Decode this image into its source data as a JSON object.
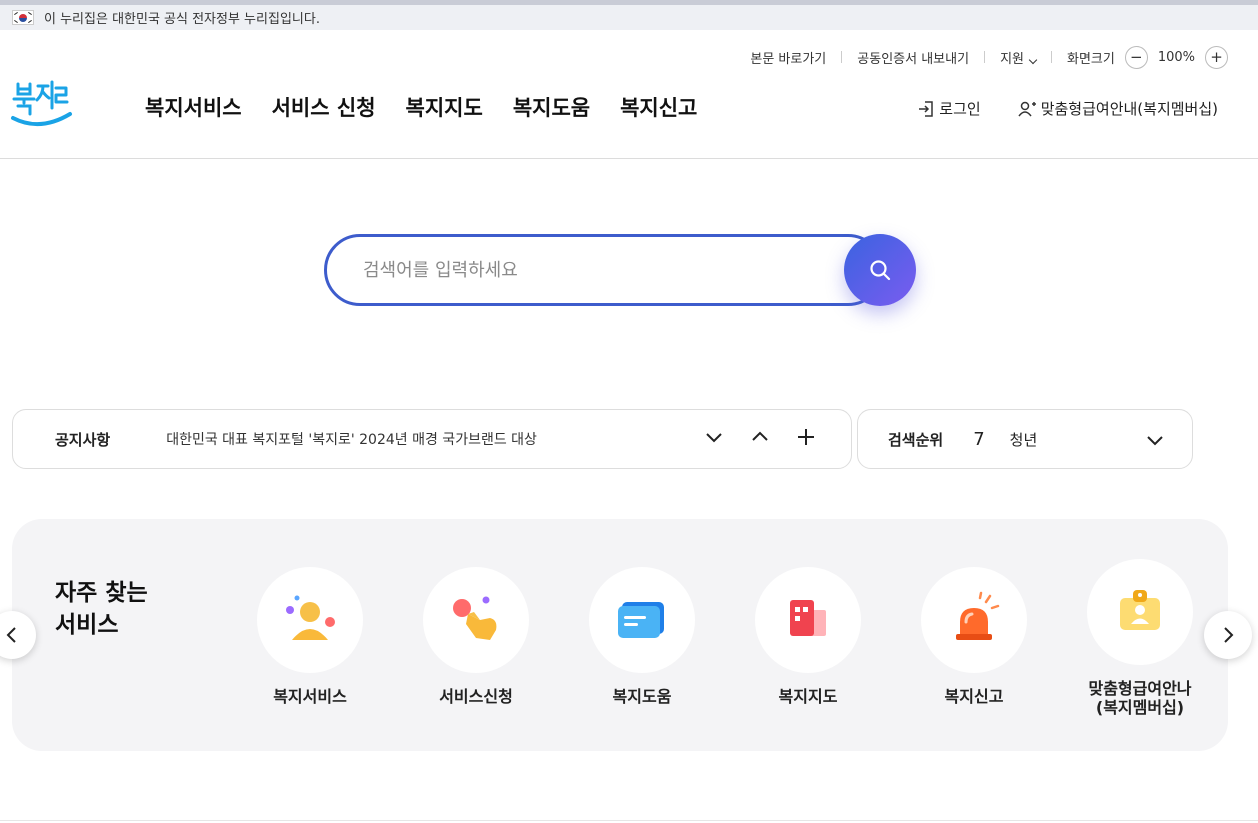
{
  "gov_banner": {
    "text": "이 누리집은 대한민국 공식 전자정부 누리집입니다."
  },
  "utility": {
    "skip_link": "본문 바로가기",
    "cert_export": "공동인증서 내보내기",
    "support": "지원",
    "screen_size_label": "화면크기",
    "zoom_value": "100%",
    "zoom_out": "−",
    "zoom_in": "+"
  },
  "logo": {
    "text": "복지로"
  },
  "gnb": {
    "items": [
      "복지서비스",
      "서비스 신청",
      "복지지도",
      "복지도움",
      "복지신고"
    ]
  },
  "user_menu": {
    "login": "로그인",
    "membership": "맞춤형급여안내(복지멤버십)"
  },
  "search": {
    "placeholder": "검색어를 입력하세요"
  },
  "notice": {
    "title": "공지사항",
    "text": "대한민국 대표 복지포털 '복지로' 2024년 매경 국가브랜드 대상"
  },
  "rank": {
    "title": "검색순위",
    "number": "7",
    "keyword": "청년"
  },
  "favorites": {
    "title_line1": "자주 찾는",
    "title_line2": "서비스",
    "items": [
      {
        "label": "복지서비스",
        "icon": "person-icon"
      },
      {
        "label": "서비스신청",
        "icon": "hand-tap-icon"
      },
      {
        "label": "복지도움",
        "icon": "chat-bubble-icon"
      },
      {
        "label": "복지지도",
        "icon": "building-icon"
      },
      {
        "label": "복지신고",
        "icon": "siren-icon"
      },
      {
        "label": "맞춤형급여안나\n(복지멤버십)",
        "label_line1": "맞춤형급여안나",
        "label_line2": "(복지멤버십)",
        "icon": "id-card-icon"
      }
    ]
  },
  "colors": {
    "primary": "#3d5ccc",
    "accent": "#7a5cf0",
    "logo_blue": "#1aa3e6"
  }
}
